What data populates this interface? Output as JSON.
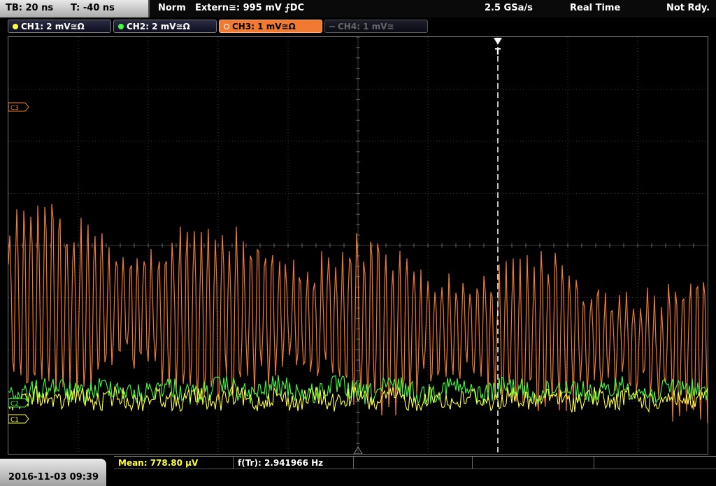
{
  "top": {
    "timebase": "TB: 20 ns",
    "trigger_offset": "T: -40 ns",
    "mode": "Norm",
    "trigger_source": "Extern≅: 995 mV ⨍DC",
    "sample_rate": "2.5 GSa/s",
    "acq_mode": "Real Time",
    "status": "Not Rdy."
  },
  "channels": [
    {
      "label": "CH1: 2 mV≅Ω",
      "color": "#ffff40",
      "state": "on"
    },
    {
      "label": "CH2: 2 mV≅Ω",
      "color": "#40ff40",
      "state": "on"
    },
    {
      "label": "CH3: 1 mV≅Ω",
      "color": "#f07a32",
      "state": "active"
    },
    {
      "label": "CH4: 1 mV≅",
      "color": "#555555",
      "state": "off"
    }
  ],
  "markers": {
    "c3": "C3",
    "c2": "C2",
    "c1": "C1",
    "trigger": "T"
  },
  "colors": {
    "ch1": "#ffff40",
    "ch2": "#40ff40",
    "ch3": "#f07a32",
    "grid": "#3a3a3a"
  },
  "bottom": {
    "datetime": "2016-11-03 09:39",
    "mean_label": "Mean: 778.80 µV",
    "freq_label": "f(Tr): 2.941966 Hz"
  }
}
